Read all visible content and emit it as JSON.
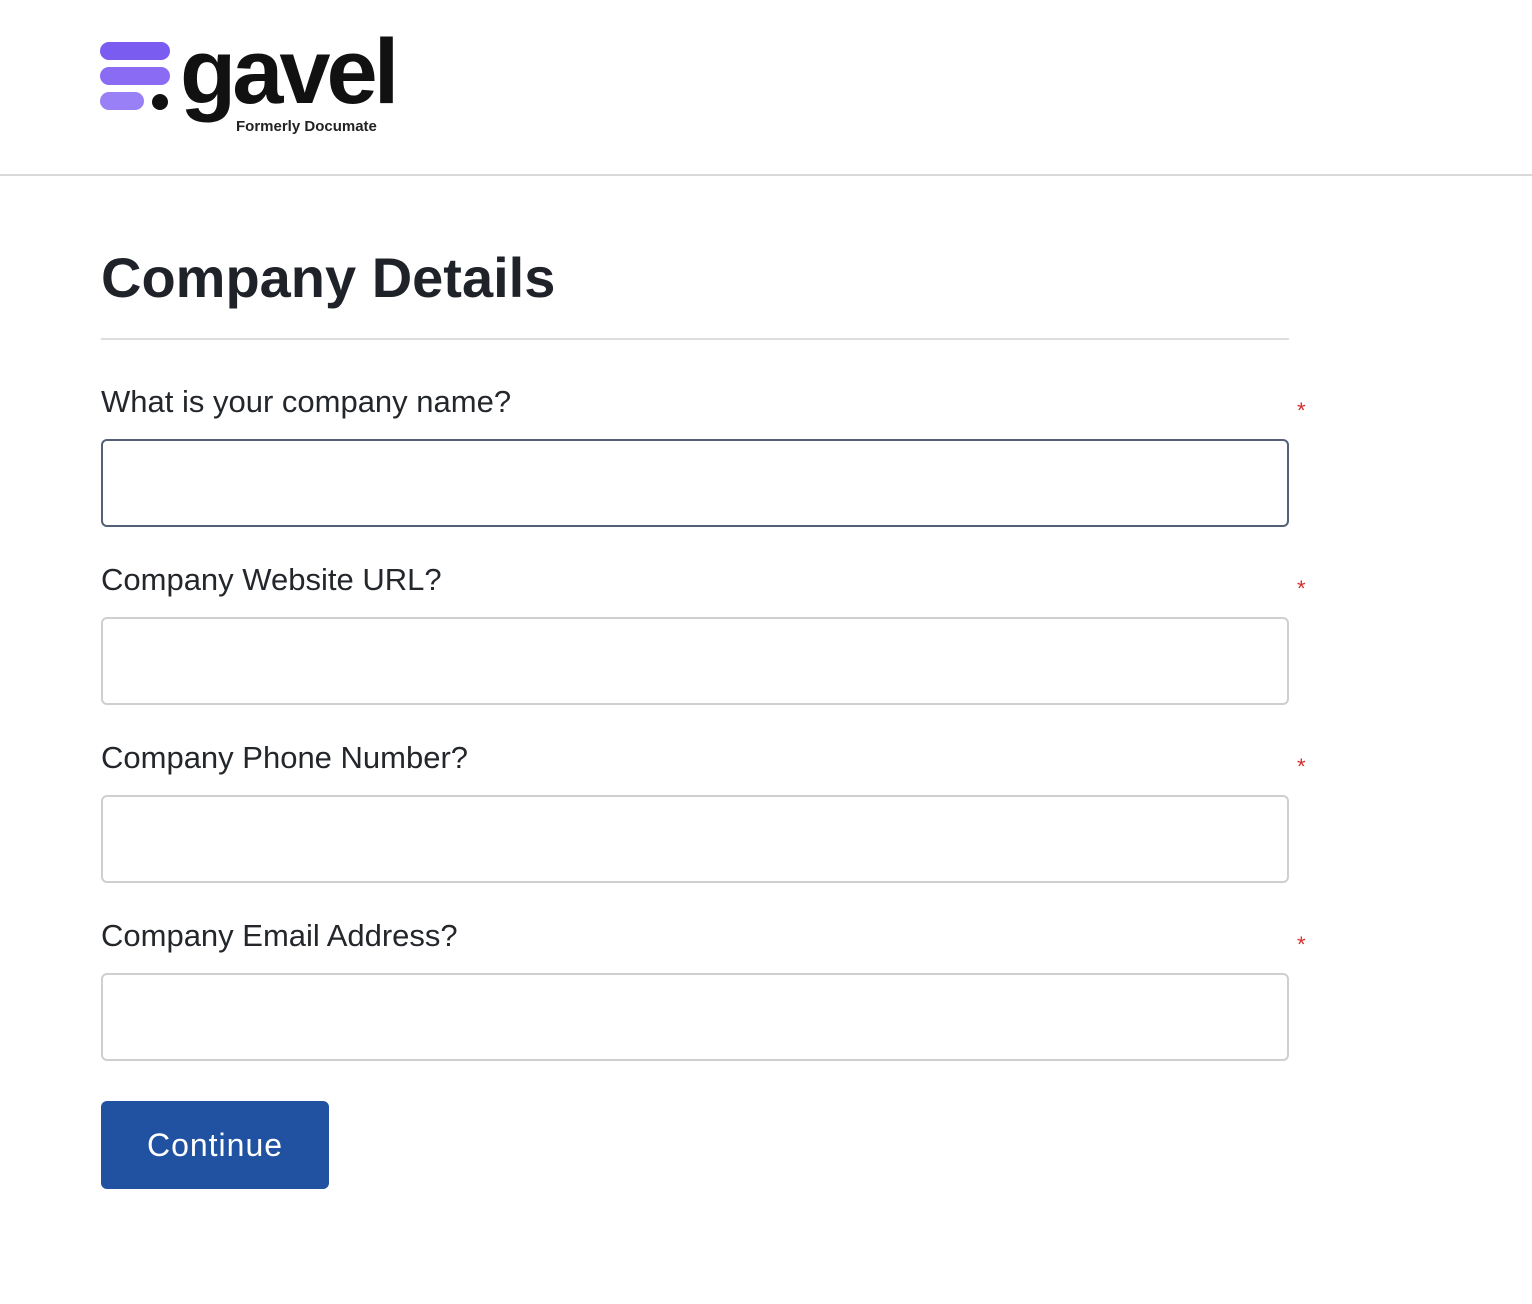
{
  "brand": {
    "name": "gavel",
    "tagline": "Formerly Documate",
    "logo_icon": "stacked-bars-dot-icon",
    "accent_color": "#7b5cf0"
  },
  "page": {
    "title": "Company Details"
  },
  "form": {
    "fields": [
      {
        "label": "What is your company name?",
        "value": "",
        "placeholder": "",
        "required_mark": "*"
      },
      {
        "label": "Company Website URL?",
        "value": "",
        "placeholder": "",
        "required_mark": "*"
      },
      {
        "label": "Company Phone Number?",
        "value": "",
        "placeholder": "",
        "required_mark": "*"
      },
      {
        "label": "Company Email Address?",
        "value": "",
        "placeholder": "",
        "required_mark": "*"
      }
    ],
    "submit_label": "Continue",
    "submit_color": "#2052a1",
    "required_color": "#d92b2b"
  }
}
